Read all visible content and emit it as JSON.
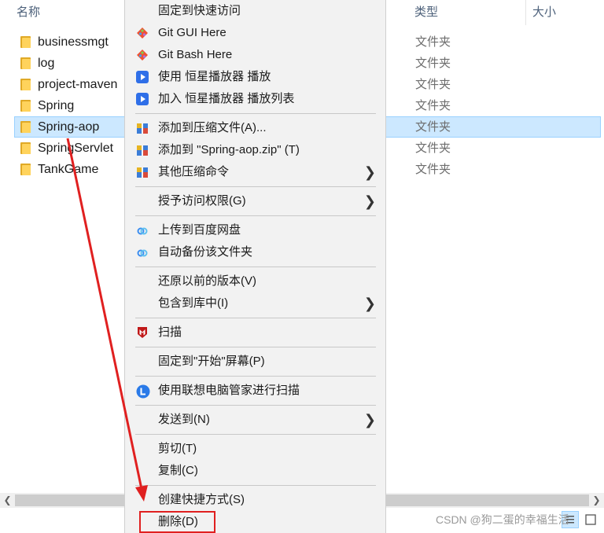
{
  "columns": {
    "name": "名称",
    "type": "类型",
    "size": "大小"
  },
  "files": [
    {
      "name": "businessmgt",
      "type": "文件夹"
    },
    {
      "name": "log",
      "type": "文件夹"
    },
    {
      "name": "project-maven",
      "type": "文件夹"
    },
    {
      "name": "Spring",
      "type": "文件夹"
    },
    {
      "name": "Spring-aop",
      "type": "文件夹",
      "selected": true
    },
    {
      "name": "SpringServlet",
      "type": "文件夹"
    },
    {
      "name": "TankGame",
      "type": "文件夹"
    }
  ],
  "context_menu": {
    "items": [
      {
        "label": "固定到快速访问"
      },
      {
        "label": "Git GUI Here",
        "icon": "git-gui-icon"
      },
      {
        "label": "Git Bash Here",
        "icon": "git-bash-icon"
      },
      {
        "label": "使用 恒星播放器 播放",
        "icon": "player-icon"
      },
      {
        "label": "加入 恒星播放器 播放列表",
        "icon": "player-icon"
      },
      {
        "label": "添加到压缩文件(A)...",
        "icon": "archive-icon"
      },
      {
        "label": "添加到 \"Spring-aop.zip\" (T)",
        "icon": "archive-icon"
      },
      {
        "label": "其他压缩命令",
        "icon": "archive-icon",
        "submenu": true
      },
      {
        "label": "授予访问权限(G)",
        "submenu": true
      },
      {
        "label": "上传到百度网盘",
        "icon": "baidu-cloud-icon"
      },
      {
        "label": "自动备份该文件夹",
        "icon": "baidu-cloud-icon"
      },
      {
        "label": "还原以前的版本(V)"
      },
      {
        "label": "包含到库中(I)",
        "submenu": true
      },
      {
        "label": "扫描",
        "icon": "mcafee-icon"
      },
      {
        "label": "固定到\"开始\"屏幕(P)"
      },
      {
        "label": "使用联想电脑管家进行扫描",
        "icon": "lenovo-icon"
      },
      {
        "label": "发送到(N)",
        "submenu": true
      },
      {
        "label": "剪切(T)"
      },
      {
        "label": "复制(C)"
      },
      {
        "label": "创建快捷方式(S)"
      },
      {
        "label": "删除(D)",
        "highlighted": true
      }
    ],
    "submenu_arrow": "❯"
  },
  "colors": {
    "annotation": "#e02020",
    "selection": "#cce8ff"
  },
  "watermark": "CSDN @狗二蛋的幸福生活"
}
